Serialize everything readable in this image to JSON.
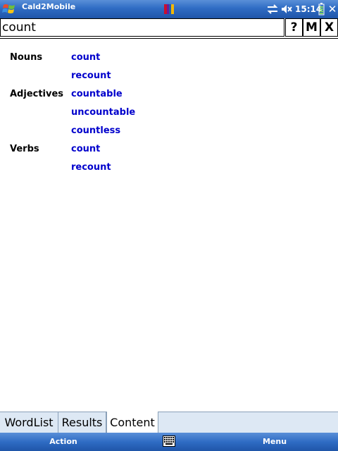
{
  "titlebar": {
    "app_title": "Cald2Mobile",
    "clock": "15:14",
    "close": "✕"
  },
  "search": {
    "value": "count",
    "buttons": {
      "help": "?",
      "m": "M",
      "x": "X"
    }
  },
  "entries": {
    "nouns": {
      "label": "Nouns",
      "words": [
        "count",
        "recount"
      ]
    },
    "adjectives": {
      "label": "Adjectives",
      "words": [
        "countable",
        "uncountable",
        "countless"
      ]
    },
    "verbs": {
      "label": "Verbs",
      "words": [
        "count",
        "recount"
      ]
    }
  },
  "tabs": [
    "WordList",
    "Results",
    "Content"
  ],
  "active_tab": "Content",
  "softkeys": {
    "left": "Action",
    "right": "Menu"
  },
  "colors": {
    "titlebar": "#2f6cc4",
    "link": "#0000cc",
    "tab_bg": "#dde8f4"
  }
}
